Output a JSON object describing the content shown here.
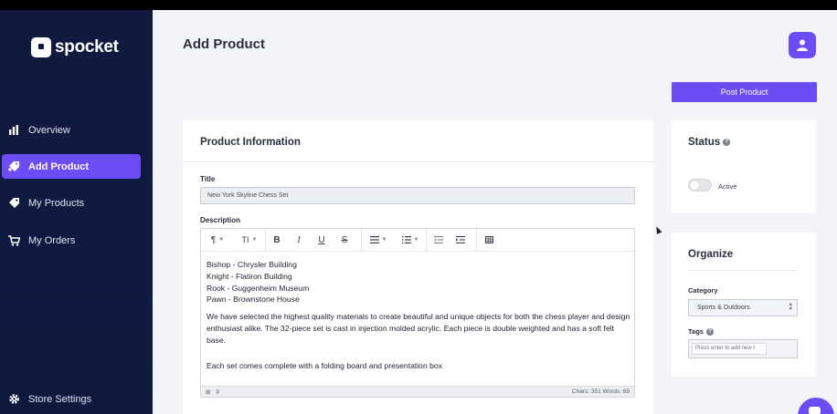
{
  "brand": {
    "name": "spocket"
  },
  "sidebar": {
    "items": [
      {
        "label": "Overview",
        "icon": "bar-chart-icon"
      },
      {
        "label": "Add Product",
        "icon": "tag-plus-icon",
        "active": true
      },
      {
        "label": "My Products",
        "icon": "tag-icon"
      },
      {
        "label": "My Orders",
        "icon": "cart-icon"
      }
    ],
    "footer_item": {
      "label": "Store Settings",
      "icon": "gear-icon"
    }
  },
  "header": {
    "title": "Add Product"
  },
  "actions": {
    "post_label": "Post Product"
  },
  "product_info": {
    "heading": "Product Information",
    "title_label": "Title",
    "title_value": "New York Skyline Chess Set",
    "description_label": "Description",
    "toolbar": {
      "paragraph": "¶",
      "text_size": "TI",
      "bold": "B",
      "italic": "I",
      "underline": "U",
      "strike": "S"
    },
    "description_lines": [
      "Bishop - Chrysler Building",
      "Knight - Flatiron Building",
      "Rook - Guggenheim Museum",
      "Pawn - Brownstone House"
    ],
    "description_paragraph": "We have selected the highest quality materials to create beautiful and unique objects for both the chess player and design enthusiast alike. The 32-piece set is cast in injection molded acrylic. Each piece is double weighted and has a soft felt base.",
    "description_closing": "Each set comes complete with a folding board and presentation box",
    "footer_path": "p",
    "footer_counts": "Chars: 351  Words: 69"
  },
  "status": {
    "heading": "Status",
    "toggle_label": "Active",
    "active": false
  },
  "organize": {
    "heading": "Organize",
    "category_label": "Category",
    "category_value": "Sports & Outdoors",
    "tags_label": "Tags",
    "tags_placeholder": "Press enter to add new t"
  },
  "colors": {
    "accent": "#6c4cf5",
    "sidebar_bg": "#101a3f",
    "page_bg": "#f3f4f8"
  }
}
